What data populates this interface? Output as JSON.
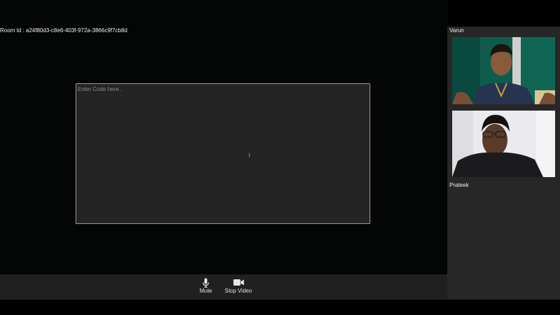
{
  "room": {
    "id_label": "Room Id : a24f80d3-c8e6-403f-972a-3866c9f7cb8d"
  },
  "editor": {
    "placeholder": "Enter Code here.."
  },
  "controls": {
    "mute_label": "Mute",
    "mute_icon": "microphone-icon",
    "video_label": "Stop Video",
    "video_icon": "video-camera-icon"
  },
  "participants": [
    {
      "name": "Varun"
    },
    {
      "name": "Prateek"
    }
  ],
  "colors": {
    "stage_background": "#030604",
    "editor_background": "#242424",
    "control_bar": "#202020",
    "sidebar": "#272727",
    "text": "#f2f2f2"
  }
}
